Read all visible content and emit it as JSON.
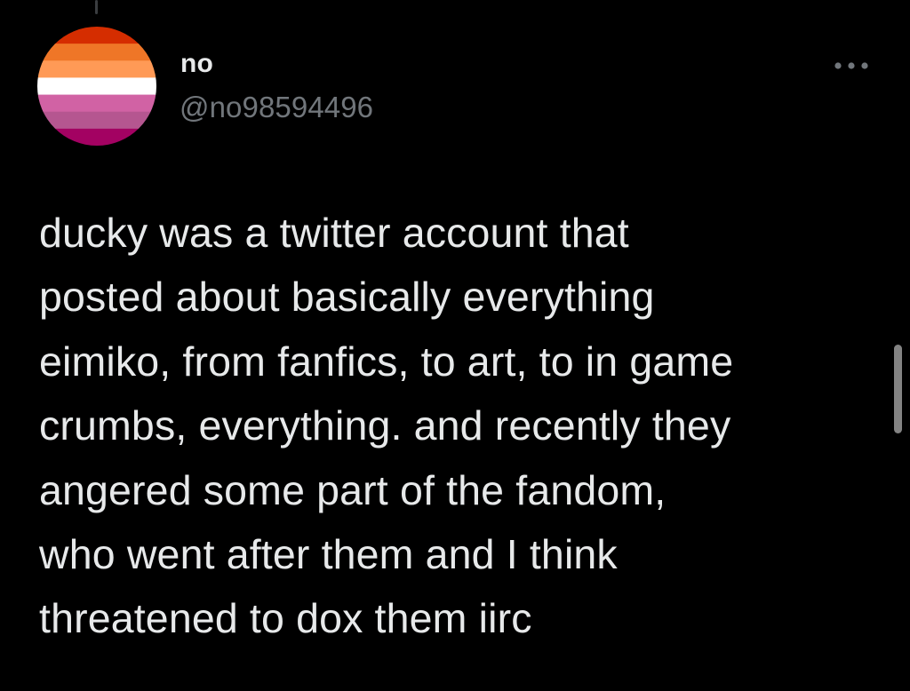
{
  "tweet": {
    "author": {
      "display_name": "no",
      "handle": "@no98594496",
      "avatar_icon": "lesbian-pride-flag-avatar",
      "avatar_colors": [
        "#d52d00",
        "#ef7627",
        "#ff9a56",
        "#ffffff",
        "#d162a4",
        "#b55690",
        "#a30262"
      ]
    },
    "more_icon": "more-horizontal-icon",
    "text": "ducky was a twitter account that\nposted about basically everything\neimiko, from fanfics, to art, to in game\ncrumbs, everything. and recently they\nangered some part of the fandom,\nwho went after them and I think\nthreatened to dox them iirc"
  },
  "colors": {
    "background": "#000000",
    "primary_text": "#e7e9ea",
    "secondary_text": "#71767b",
    "thread_line": "#3a3d40"
  }
}
